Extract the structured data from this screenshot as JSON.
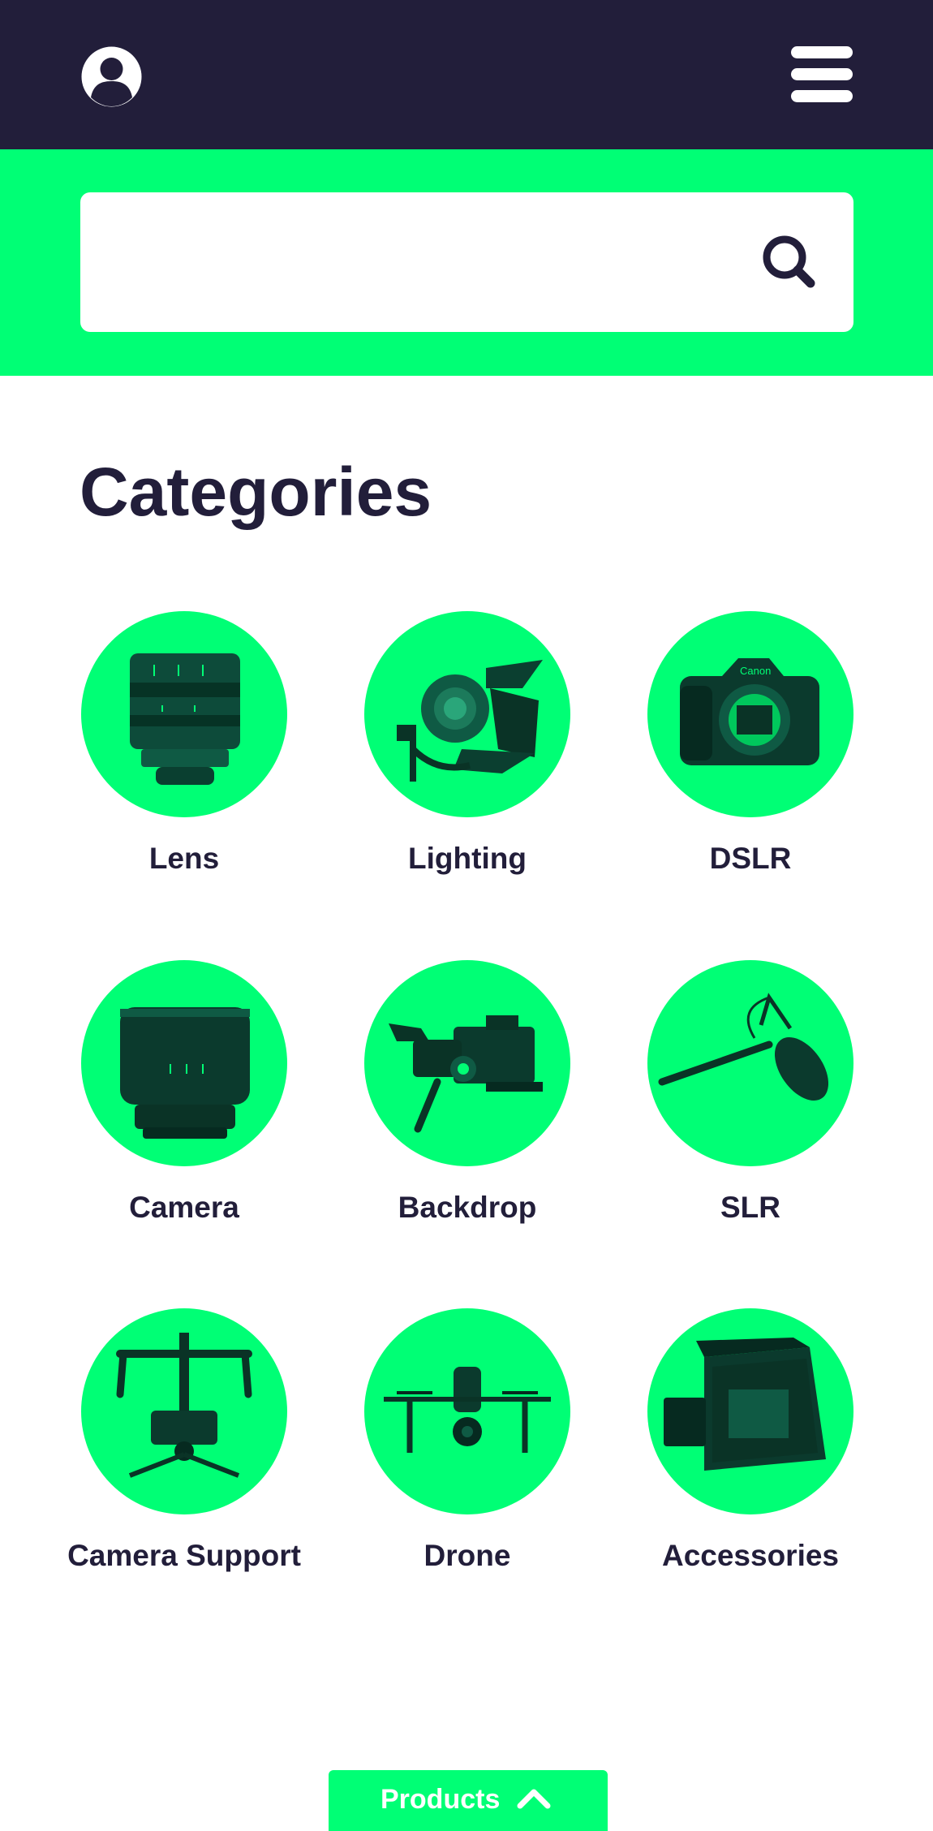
{
  "header": {
    "profile_icon": "user-circle-icon",
    "menu_icon": "hamburger-menu-icon",
    "background_color": "#221e3a"
  },
  "search": {
    "value": "",
    "placeholder": "",
    "button_icon": "search-icon",
    "band_color": "#00ff75"
  },
  "main": {
    "title": "Categories",
    "categories": [
      {
        "label": "Lens",
        "icon": "cine-lens-icon"
      },
      {
        "label": "Lighting",
        "icon": "spotlight-icon"
      },
      {
        "label": "DSLR",
        "icon": "dslr-body-icon"
      },
      {
        "label": "Camera",
        "icon": "camera-lens-icon"
      },
      {
        "label": "Backdrop",
        "icon": "cinema-camera-rig-icon"
      },
      {
        "label": "SLR",
        "icon": "boom-microphone-icon"
      },
      {
        "label": "Camera Support",
        "icon": "gimbal-stabilizer-icon"
      },
      {
        "label": "Drone",
        "icon": "drone-icon"
      },
      {
        "label": "Accessories",
        "icon": "matte-box-icon"
      }
    ]
  },
  "footer": {
    "products_label": "Products",
    "products_icon": "chevron-up-icon"
  },
  "colors": {
    "accent": "#00ff75",
    "dark": "#221e3a",
    "white": "#ffffff"
  }
}
